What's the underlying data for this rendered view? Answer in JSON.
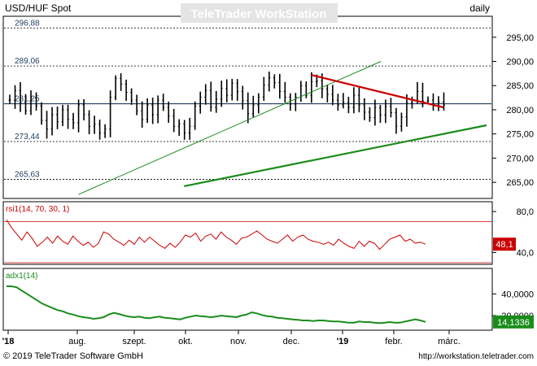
{
  "header": {
    "symbol": "USD/HUF Spot",
    "watermark": "TeleTrader WorkStation",
    "period": "daily"
  },
  "footer": {
    "copyright": "© 2019 TeleTrader Software GmbH",
    "url": "http://workstation.teletrader.com"
  },
  "colors": {
    "price": "#000000",
    "horizontal_levels": "#000000",
    "mid_level": "#1f3a5f",
    "resistance_trend": "#cc0000",
    "support_trend": "#1a8c1a",
    "rsi_line": "#cc0000",
    "rsi_bands": "#cc0000",
    "adx_line": "#1a8c1a",
    "rsi_badge": "#cc0000",
    "adx_badge": "#1a8c1a"
  },
  "x_axis": {
    "labels": [
      "'18",
      "aug.",
      "szept.",
      "okt.",
      "nov.",
      "dec.",
      "'19",
      "febr.",
      "márc."
    ]
  },
  "chart_data": [
    {
      "type": "line",
      "name": "price",
      "ylim": [
        262,
        299
      ],
      "y_ticks": [
        "265,00",
        "270,00",
        "275,00",
        "280,00",
        "285,00",
        "290,00",
        "295,00"
      ],
      "levels": [
        {
          "label": "296,88",
          "value": 296.88
        },
        {
          "label": "289,06",
          "value": 289.06
        },
        {
          "label": "281,25",
          "value": 281.25
        },
        {
          "label": "273,44",
          "value": 273.44
        },
        {
          "label": "265,63",
          "value": 265.63
        }
      ],
      "close": [
        282.0,
        284.0,
        281.5,
        279.8,
        282.5,
        280.8,
        277.8,
        276.0,
        279.0,
        277.5,
        280.0,
        278.0,
        277.3,
        281.0,
        279.0,
        276.6,
        277.0,
        275.2,
        276.0,
        282.6,
        286.5,
        285.3,
        283.6,
        282.0,
        279.8,
        278.0,
        281.0,
        279.0,
        282.0,
        280.5,
        278.7,
        276.6,
        277.1,
        275.2,
        276.6,
        280.8,
        282.6,
        284.0,
        280.5,
        282.2,
        284.4,
        283.0,
        285.5,
        283.8,
        281.9,
        279.2,
        281.0,
        282.6,
        285.1,
        286.6,
        285.6,
        283.8,
        282.6,
        281.2,
        282.6,
        285.0,
        283.0,
        285.8,
        286.0,
        284.3,
        283.2,
        282.0,
        281.0,
        281.5,
        280.5,
        283.0,
        281.0,
        279.5,
        278.4,
        280.4,
        278.9,
        280.7,
        279.4,
        276.6,
        278.5,
        281.5,
        282.0,
        283.8,
        281.8,
        282.0,
        280.8,
        281.6,
        281.0
      ],
      "trendlines": [
        {
          "from": [
            0.15,
            262.5
          ],
          "to": [
            0.78,
            290.0
          ],
          "style": "thin"
        },
        {
          "from": [
            0.37,
            264.2
          ],
          "to": [
            1.0,
            276.8
          ],
          "style": "thick"
        },
        {
          "from": [
            0.635,
            287.2
          ],
          "to": [
            0.91,
            280.5
          ],
          "style": "thick"
        }
      ]
    },
    {
      "type": "line",
      "name": "rsi1(14, 70, 30, 1)",
      "ylim": [
        30,
        88
      ],
      "y_ticks": [
        "40,0",
        "80,0"
      ],
      "bands": [
        70,
        30
      ],
      "last_value": "48,1",
      "values": [
        72,
        64,
        58,
        52,
        60,
        54,
        46,
        50,
        55,
        49,
        56,
        51,
        48,
        56,
        51,
        47,
        50,
        45,
        49,
        60,
        58,
        53,
        50,
        47,
        52,
        48,
        55,
        50,
        55,
        51,
        47,
        44,
        49,
        45,
        50,
        57,
        55,
        59,
        51,
        56,
        58,
        53,
        60,
        55,
        52,
        48,
        54,
        55,
        58,
        61,
        57,
        53,
        51,
        49,
        53,
        57,
        51,
        55,
        57,
        53,
        51,
        50,
        48,
        50,
        47,
        53,
        49,
        46,
        44,
        51,
        46,
        51,
        49,
        43,
        48,
        53,
        55,
        57,
        51,
        53,
        49,
        50,
        48.1
      ]
    },
    {
      "type": "line",
      "name": "adx1(14)",
      "ylim": [
        8,
        62
      ],
      "y_ticks": [
        "20,0000",
        "40,0000"
      ],
      "last_value": "14,1336",
      "values": [
        47,
        47,
        46,
        43,
        40,
        37,
        34,
        31,
        29,
        27,
        25,
        24,
        22,
        21,
        19.5,
        18.5,
        18,
        17,
        17.5,
        18.5,
        21,
        22.5,
        21.5,
        20,
        19,
        18.5,
        19,
        18,
        17.5,
        18.5,
        19,
        18,
        17.5,
        17,
        16.5,
        18,
        19,
        20,
        19.5,
        19,
        18.5,
        19,
        20,
        19.5,
        19,
        18.5,
        20,
        21,
        23,
        22,
        20.5,
        19.5,
        19,
        18,
        17.5,
        17,
        16.5,
        16,
        15.5,
        15.5,
        15,
        15.5,
        15.5,
        15,
        14.5,
        14.5,
        14,
        13.5,
        13.5,
        14.5,
        14,
        14,
        13.5,
        13,
        13.5,
        14,
        13.5,
        13.5,
        14.5,
        15.5,
        16.5,
        15.5,
        14.1336
      ]
    }
  ]
}
